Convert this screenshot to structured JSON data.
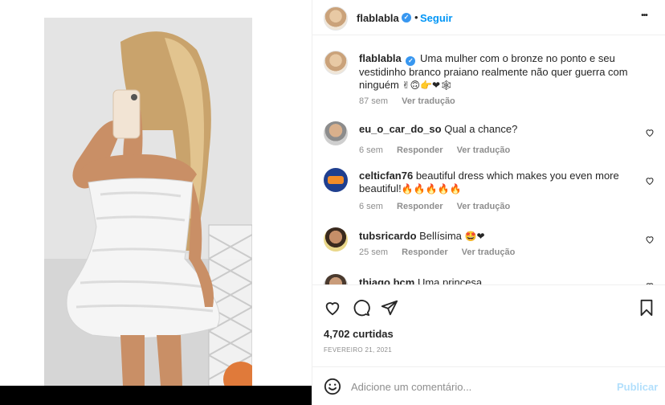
{
  "post": {
    "author": "flablabla",
    "follow_label": "Seguir",
    "more_glyph": "•••",
    "verified_glyph": "✓"
  },
  "caption": {
    "author": "flablabla",
    "text": "Uma mulher com o bronze no ponto e seu vestidinho branco praiano realmente não quer guerra com ninguém",
    "emojis": "✌🙃👉❤🕸",
    "time": "87 sem",
    "translate": "Ver tradução"
  },
  "comments": [
    {
      "author": "eu_o_car_do_so",
      "text": "Qual a chance?",
      "emojis": "",
      "time": "6 sem",
      "reply": "Responder",
      "translate": "Ver tradução"
    },
    {
      "author": "celticfan76",
      "text": "beautiful dress which makes you even more beautiful!",
      "emojis": "🔥🔥🔥🔥🔥",
      "time": "6 sem",
      "reply": "Responder",
      "translate": "Ver tradução"
    },
    {
      "author": "tubsricardo",
      "text": "Bellísima",
      "emojis": "🤩❤",
      "time": "25 sem",
      "reply": "Responder",
      "translate": "Ver tradução"
    },
    {
      "author": "thiago.bcm",
      "text": "Uma princesa",
      "emojis": "",
      "time": "",
      "reply": "",
      "translate": ""
    }
  ],
  "stats": {
    "likes": "4,702 curtidas",
    "date": "FEVEREIRO 21, 2021"
  },
  "add_comment": {
    "placeholder": "Adicione um comentário...",
    "publish_label": "Publicar"
  },
  "colors": {
    "accent": "#0095f6",
    "verified": "#3897f0",
    "muted": "#8e8e8e",
    "publish_disabled": "#b2dffc"
  }
}
